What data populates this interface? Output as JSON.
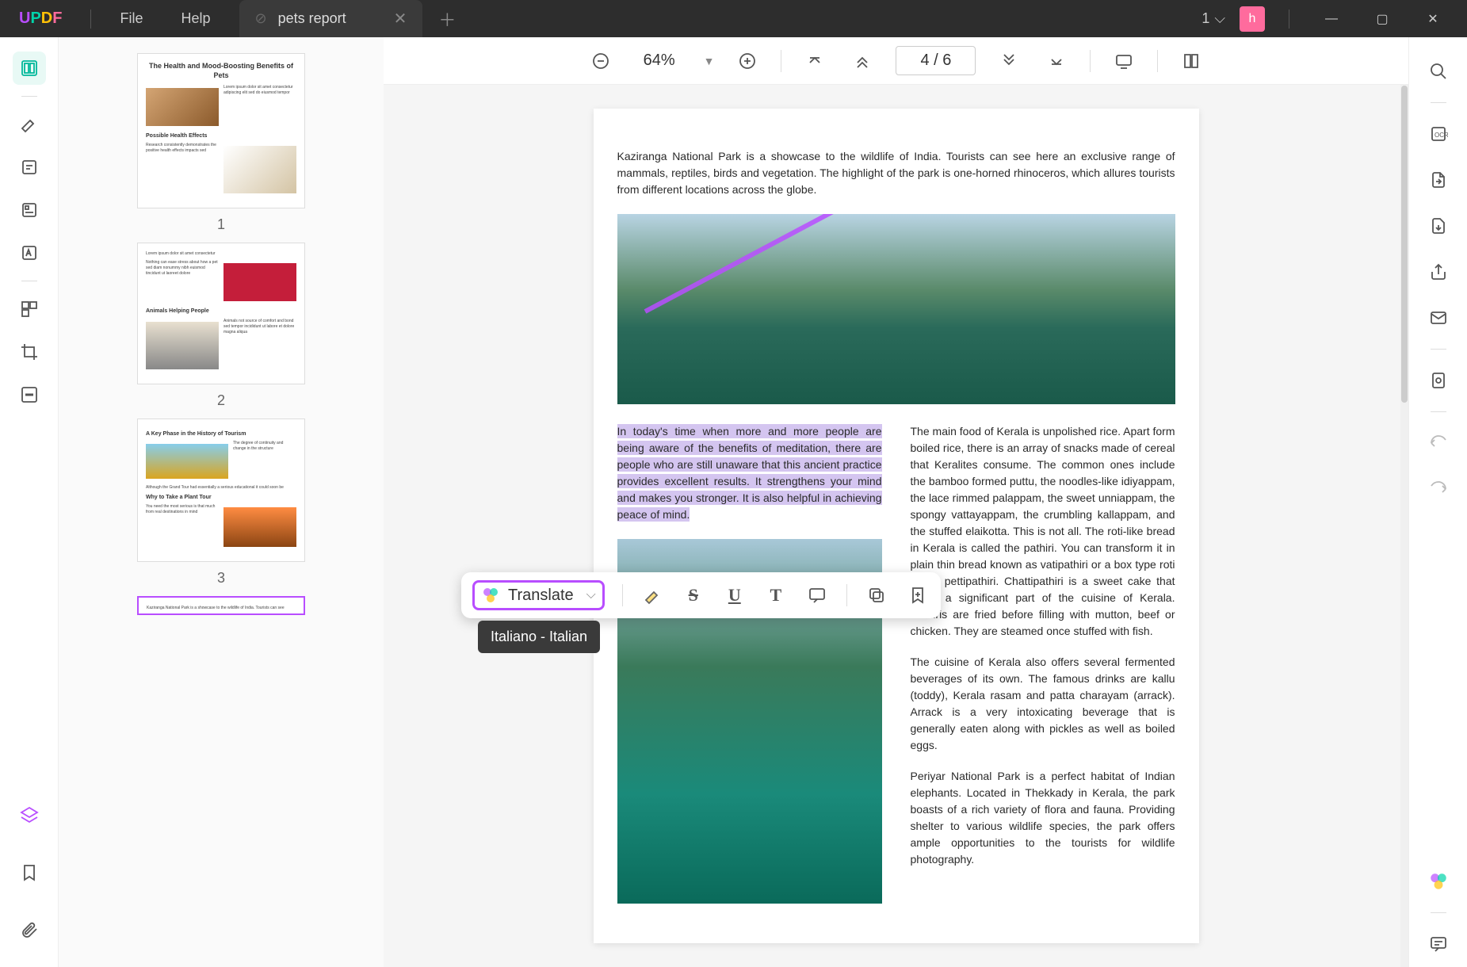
{
  "app": {
    "logo": "UPDF",
    "menu": {
      "file": "File",
      "help": "Help"
    }
  },
  "tab": {
    "title": "pets report"
  },
  "titlebar": {
    "windowCount": "1",
    "avatar": "h"
  },
  "toolbar": {
    "zoom": "64%",
    "pageIndicator": "4 / 6"
  },
  "thumbnails": {
    "page1": {
      "title": "The Health and Mood-Boosting Benefits of Pets",
      "sub1": "Possible Health Effects",
      "num": "1"
    },
    "page2": {
      "sub1": "Animals Helping People",
      "num": "2"
    },
    "page3": {
      "title": "A Key Phase in the History of Tourism",
      "sub1": "Why to Take a Plant Tour",
      "num": "3"
    }
  },
  "document": {
    "para1": "Kaziranga National Park is a showcase to the wildlife of India. Tourists can see here an exclusive range of mammals, reptiles, birds and vegetation. The highlight of the park is one-horned rhinoceros, which allures tourists from different locations across the globe.",
    "leftCol": "In today's time when more and more people are being aware of the benefits of meditation, there are people who are still unaware that this ancient practice provides excellent results. It strengthens your mind and makes you stronger. It is also helpful in achieving peace of mind.",
    "rightCol1": "The main food of Kerala is unpolished rice. Apart form boiled rice, there is an array of snacks made of cereal that Keralites consume. The common ones include the bamboo formed puttu, the noodles-like idiyappam, the lace rimmed palappam, the sweet unniappam, the spongy vattayappam, the crumbling kallappam, and the stuffed elaikotta. This is not all. The roti-like bread in Kerala is called the pathiri. You can transform it in plain thin bread known as vatipathiri or a box type roti called pettipathiri. Chattipathiri is a sweet cake that forms a significant part of the cuisine of Kerala. Pathiris are fried before filling with mutton, beef or chicken. They are steamed once stuffed with fish.",
    "rightCol2": "The cuisine of Kerala also offers several fermented beverages of its own. The famous drinks are kallu (toddy), Kerala rasam and patta charayam (arrack). Arrack is a very intoxicating beverage that is generally eaten along with pickles as well as boiled eggs.",
    "rightCol3": "Periyar National Park is a perfect habitat of Indian elephants. Located in Thekkady in Kerala, the park boasts of a rich variety of flora and fauna. Providing shelter to various wildlife species, the park offers ample opportunities to the tourists for wildlife photography."
  },
  "contextMenu": {
    "translate": "Translate",
    "tooltip": "Italiano - Italian"
  }
}
